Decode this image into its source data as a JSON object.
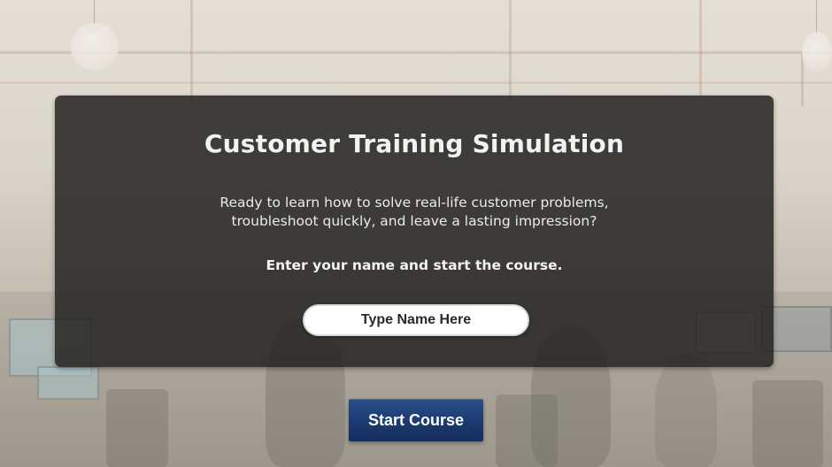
{
  "panel": {
    "title": "Customer Training Simulation",
    "intro_line1": "Ready to learn how to solve real-life customer problems,",
    "intro_line2": "troubleshoot quickly, and leave a lasting impression?",
    "prompt": "Enter your name and start the course."
  },
  "name_input": {
    "placeholder": "Type Name Here",
    "value": ""
  },
  "start_button": {
    "label": "Start Course"
  },
  "colors": {
    "panel_bg": "#242321",
    "button_bg": "#1c3a70",
    "input_bg": "#ffffff",
    "text_light": "#f2f2f2"
  }
}
